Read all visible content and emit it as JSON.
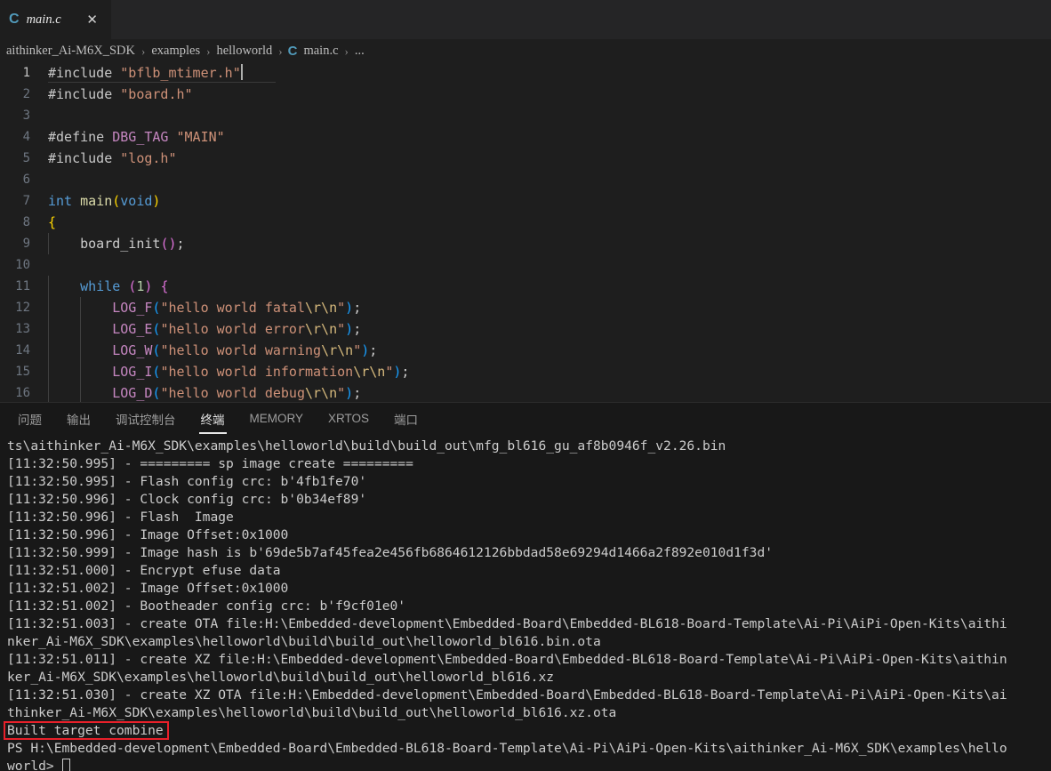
{
  "window": {
    "theme": "vscode-dark",
    "accent": "#519aba",
    "background": "#1e1e1e",
    "annotation_color": "#e8202a"
  },
  "tabbar": {
    "tabs": [
      {
        "icon": "c-file-icon",
        "icon_glyph": "C",
        "label": "main.c",
        "preview_italic": true,
        "active": true,
        "close_glyph": "✕"
      }
    ]
  },
  "breadcrumb": {
    "separator": "›",
    "items": [
      {
        "label": "aithinker_Ai-M6X_SDK",
        "icon": ""
      },
      {
        "label": "examples",
        "icon": ""
      },
      {
        "label": "helloworld",
        "icon": ""
      },
      {
        "label": "main.c",
        "icon": "c-file-icon",
        "icon_glyph": "C"
      },
      {
        "label": "...",
        "icon": ""
      }
    ]
  },
  "editor": {
    "language": "c",
    "filename": "main.c",
    "first_visible_line": 1,
    "lines": [
      {
        "n": "1",
        "tokens": [
          {
            "t": "#include ",
            "c": "t-incl"
          },
          {
            "t": "\"bflb_mtimer.h\"",
            "c": "t-str"
          }
        ]
      },
      {
        "n": "2",
        "tokens": [
          {
            "t": "#include ",
            "c": "t-incl"
          },
          {
            "t": "\"board.h\"",
            "c": "t-str"
          }
        ]
      },
      {
        "n": "3",
        "tokens": []
      },
      {
        "n": "4",
        "tokens": [
          {
            "t": "#define ",
            "c": "t-incl"
          },
          {
            "t": "DBG_TAG",
            "c": "t-def"
          },
          {
            "t": " ",
            "c": "t-punct"
          },
          {
            "t": "\"MAIN\"",
            "c": "t-str"
          }
        ]
      },
      {
        "n": "5",
        "tokens": [
          {
            "t": "#include ",
            "c": "t-incl"
          },
          {
            "t": "\"log.h\"",
            "c": "t-str"
          }
        ]
      },
      {
        "n": "6",
        "tokens": []
      },
      {
        "n": "7",
        "tokens": [
          {
            "t": "int ",
            "c": "t-kw"
          },
          {
            "t": "main",
            "c": "t-fn"
          },
          {
            "t": "(",
            "c": "t-p1"
          },
          {
            "t": "void",
            "c": "t-kw"
          },
          {
            "t": ")",
            "c": "t-p1"
          }
        ]
      },
      {
        "n": "8",
        "tokens": [
          {
            "t": "{",
            "c": "t-p1"
          }
        ]
      },
      {
        "n": "9",
        "tokens": [
          {
            "t": "    board_init",
            "c": "t-punct"
          },
          {
            "t": "(",
            "c": "t-p2"
          },
          {
            "t": ")",
            "c": "t-p2"
          },
          {
            "t": ";",
            "c": "t-punct"
          }
        ]
      },
      {
        "n": "10",
        "tokens": []
      },
      {
        "n": "11",
        "tokens": [
          {
            "t": "    ",
            "c": "t-punct"
          },
          {
            "t": "while ",
            "c": "t-kw"
          },
          {
            "t": "(",
            "c": "t-p2"
          },
          {
            "t": "1",
            "c": "t-num"
          },
          {
            "t": ")",
            "c": "t-p2"
          },
          {
            "t": " ",
            "c": "t-punct"
          },
          {
            "t": "{",
            "c": "t-p2"
          }
        ]
      },
      {
        "n": "12",
        "tokens": [
          {
            "t": "        ",
            "c": "t-punct"
          },
          {
            "t": "LOG_F",
            "c": "t-macro"
          },
          {
            "t": "(",
            "c": "t-p3"
          },
          {
            "t": "\"hello world fatal",
            "c": "t-str"
          },
          {
            "t": "\\r\\n",
            "c": "t-esc"
          },
          {
            "t": "\"",
            "c": "t-str"
          },
          {
            "t": ")",
            "c": "t-p3"
          },
          {
            "t": ";",
            "c": "t-punct"
          }
        ]
      },
      {
        "n": "13",
        "tokens": [
          {
            "t": "        ",
            "c": "t-punct"
          },
          {
            "t": "LOG_E",
            "c": "t-macro"
          },
          {
            "t": "(",
            "c": "t-p3"
          },
          {
            "t": "\"hello world error",
            "c": "t-str"
          },
          {
            "t": "\\r\\n",
            "c": "t-esc"
          },
          {
            "t": "\"",
            "c": "t-str"
          },
          {
            "t": ")",
            "c": "t-p3"
          },
          {
            "t": ";",
            "c": "t-punct"
          }
        ]
      },
      {
        "n": "14",
        "tokens": [
          {
            "t": "        ",
            "c": "t-punct"
          },
          {
            "t": "LOG_W",
            "c": "t-macro"
          },
          {
            "t": "(",
            "c": "t-p3"
          },
          {
            "t": "\"hello world warning",
            "c": "t-str"
          },
          {
            "t": "\\r\\n",
            "c": "t-esc"
          },
          {
            "t": "\"",
            "c": "t-str"
          },
          {
            "t": ")",
            "c": "t-p3"
          },
          {
            "t": ";",
            "c": "t-punct"
          }
        ]
      },
      {
        "n": "15",
        "tokens": [
          {
            "t": "        ",
            "c": "t-punct"
          },
          {
            "t": "LOG_I",
            "c": "t-macro"
          },
          {
            "t": "(",
            "c": "t-p3"
          },
          {
            "t": "\"hello world information",
            "c": "t-str"
          },
          {
            "t": "\\r\\n",
            "c": "t-esc"
          },
          {
            "t": "\"",
            "c": "t-str"
          },
          {
            "t": ")",
            "c": "t-p3"
          },
          {
            "t": ";",
            "c": "t-punct"
          }
        ]
      },
      {
        "n": "16",
        "tokens": [
          {
            "t": "        ",
            "c": "t-punct"
          },
          {
            "t": "LOG_D",
            "c": "t-macro"
          },
          {
            "t": "(",
            "c": "t-p3"
          },
          {
            "t": "\"hello world debug",
            "c": "t-str"
          },
          {
            "t": "\\r\\n",
            "c": "t-esc"
          },
          {
            "t": "\"",
            "c": "t-str"
          },
          {
            "t": ")",
            "c": "t-p3"
          },
          {
            "t": ";",
            "c": "t-punct"
          }
        ]
      }
    ]
  },
  "panel": {
    "tabs": [
      {
        "label": "问题",
        "active": false
      },
      {
        "label": "输出",
        "active": false
      },
      {
        "label": "调试控制台",
        "active": false
      },
      {
        "label": "终端",
        "active": true
      },
      {
        "label": "MEMORY",
        "active": false
      },
      {
        "label": "XRTOS",
        "active": false
      },
      {
        "label": "端口",
        "active": false
      }
    ]
  },
  "terminal": {
    "shell": "powershell",
    "lines": [
      "ts\\aithinker_Ai-M6X_SDK\\examples\\helloworld\\build\\build_out\\mfg_bl616_gu_af8b0946f_v2.26.bin",
      "[11:32:50.995] - ========= sp image create =========",
      "[11:32:50.995] - Flash config crc: b'4fb1fe70'",
      "[11:32:50.996] - Clock config crc: b'0b34ef89'",
      "[11:32:50.996] - Flash  Image",
      "[11:32:50.996] - Image Offset:0x1000",
      "[11:32:50.999] - Image hash is b'69de5b7af45fea2e456fb6864612126bbdad58e69294d1466a2f892e010d1f3d'",
      "[11:32:51.000] - Encrypt efuse data",
      "[11:32:51.002] - Image Offset:0x1000",
      "[11:32:51.002] - Bootheader config crc: b'f9cf01e0'",
      "[11:32:51.003] - create OTA file:H:\\Embedded-development\\Embedded-Board\\Embedded-BL618-Board-Template\\Ai-Pi\\AiPi-Open-Kits\\aithi",
      "nker_Ai-M6X_SDK\\examples\\helloworld\\build\\build_out\\helloworld_bl616.bin.ota",
      "[11:32:51.011] - create XZ file:H:\\Embedded-development\\Embedded-Board\\Embedded-BL618-Board-Template\\Ai-Pi\\AiPi-Open-Kits\\aithin",
      "ker_Ai-M6X_SDK\\examples\\helloworld\\build\\build_out\\helloworld_bl616.xz",
      "[11:32:51.030] - create XZ OTA file:H:\\Embedded-development\\Embedded-Board\\Embedded-BL618-Board-Template\\Ai-Pi\\AiPi-Open-Kits\\ai",
      "thinker_Ai-M6X_SDK\\examples\\helloworld\\build\\build_out\\helloworld_bl616.xz.ota",
      "Built target combine",
      "PS H:\\Embedded-development\\Embedded-Board\\Embedded-BL618-Board-Template\\Ai-Pi\\AiPi-Open-Kits\\aithinker_Ai-M6X_SDK\\examples\\hello",
      "world> "
    ],
    "highlighted_line_index": 16,
    "highlighted_text": "Built target combine",
    "cursor_on_last_line": true
  }
}
